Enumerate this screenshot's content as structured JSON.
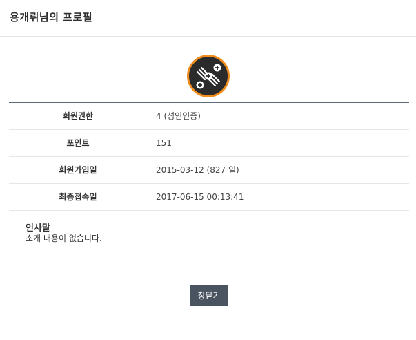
{
  "header": {
    "title": "용개뤼님의 프로필"
  },
  "avatar": {
    "icon": "level-badge-icon",
    "ring_color": "#f08c1c",
    "fill_color": "#2b2b2b"
  },
  "profile": {
    "rows": [
      {
        "label": "회원권한",
        "value": "4 (성인인증)"
      },
      {
        "label": "포인트",
        "value": "151"
      },
      {
        "label": "회원가입일",
        "value": "2015-03-12 (827 일)"
      },
      {
        "label": "최종접속일",
        "value": "2017-06-15 00:13:41"
      }
    ]
  },
  "greeting": {
    "title": "인사말",
    "text": "소개 내용이 없습니다."
  },
  "footer": {
    "close_label": "창닫기"
  }
}
